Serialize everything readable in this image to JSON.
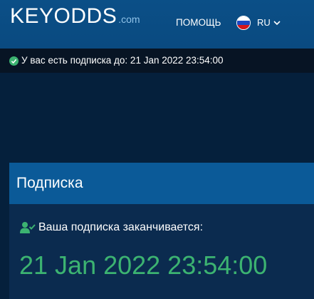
{
  "header": {
    "logo_text": "KEYODDS",
    "logo_tld": ".com",
    "help_label": "ПОМОЩЬ",
    "language_code": "RU",
    "language_flag_icon": "russia-flag-icon",
    "language_chevron_icon": "chevron-down-icon"
  },
  "subscription_bar": {
    "icon": "check-circle-icon",
    "text": "У вас есть подписка до: 21 Jan 2022 23:54:00"
  },
  "panel": {
    "title": "Подписка",
    "status_icon": "user-check-icon",
    "status_text": "Ваша подписка заканчивается:",
    "expiry_datetime": "21 Jan 2022 23:54:00"
  },
  "colors": {
    "header_bg": "#0b4f87",
    "page_bg": "#05203c",
    "status_bar_bg": "#071424",
    "panel_head_bg": "#0b5a98",
    "accent_green": "#3cb371"
  }
}
